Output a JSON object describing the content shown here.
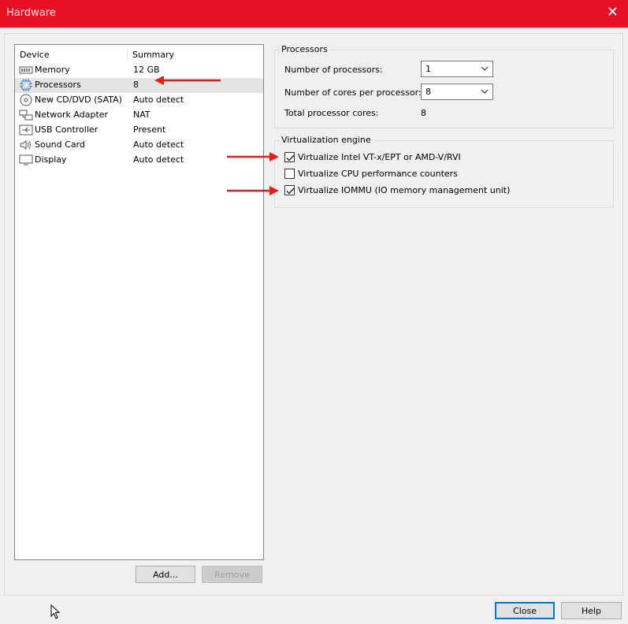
{
  "window": {
    "title": "Hardware",
    "close_glyph": "✕"
  },
  "device_list": {
    "headers": {
      "device": "Device",
      "summary": "Summary"
    },
    "rows": [
      {
        "name": "Memory",
        "summary": "12 GB",
        "icon": "memory-icon"
      },
      {
        "name": "Processors",
        "summary": "8",
        "icon": "processor-icon",
        "selected": true
      },
      {
        "name": "New CD/DVD (SATA)",
        "summary": "Auto detect",
        "icon": "cd-dvd-icon"
      },
      {
        "name": "Network Adapter",
        "summary": "NAT",
        "icon": "network-adapter-icon"
      },
      {
        "name": "USB Controller",
        "summary": "Present",
        "icon": "usb-icon"
      },
      {
        "name": "Sound Card",
        "summary": "Auto detect",
        "icon": "speaker-icon"
      },
      {
        "name": "Display",
        "summary": "Auto detect",
        "icon": "monitor-icon"
      }
    ]
  },
  "buttons": {
    "add": "Add...",
    "remove": "Remove",
    "close": "Close",
    "help": "Help"
  },
  "processors": {
    "legend": "Processors",
    "num_processors_label": "Number of processors:",
    "num_processors_value": "1",
    "cores_label": "Number of cores per processor:",
    "cores_value": "8",
    "total_label": "Total processor cores:",
    "total_value": "8"
  },
  "virtualization": {
    "legend": "Virtualization engine",
    "options": [
      {
        "label": "Virtualize Intel VT-x/EPT or AMD-V/RVI",
        "checked": true
      },
      {
        "label": "Virtualize CPU performance counters",
        "checked": false
      },
      {
        "label": "Virtualize IOMMU (IO memory management unit)",
        "checked": true
      }
    ]
  },
  "colors": {
    "titlebar": "#e81123",
    "annotation_arrow": "#e0201c",
    "selected_row": "#e5e5e5"
  }
}
